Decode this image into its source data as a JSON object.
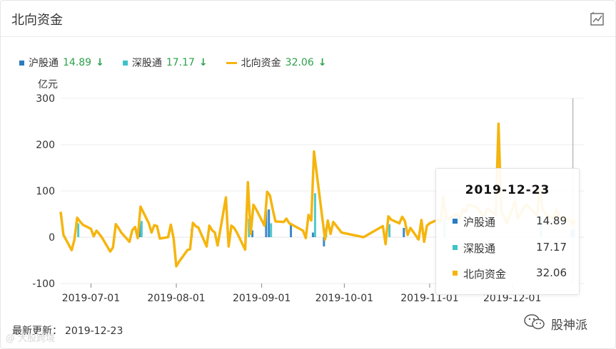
{
  "header": {
    "title": "北向资金",
    "chart_icon": "chart-line-icon"
  },
  "legend": [
    {
      "name": "沪股通",
      "value": "14.89",
      "arrow": "↓",
      "color": "#2a7bc2",
      "kind": "square"
    },
    {
      "name": "深股通",
      "value": "17.17",
      "arrow": "↓",
      "color": "#3cc3c7",
      "kind": "square"
    },
    {
      "name": "北向资金",
      "value": "32.06",
      "arrow": "↓",
      "color": "#f5b50f",
      "kind": "line"
    }
  ],
  "axis": {
    "unit": "亿元"
  },
  "footer": {
    "label": "最新更新：",
    "date": "2019-12-23"
  },
  "tooltip": {
    "date": "2019-12-23",
    "rows": [
      {
        "name": "沪股通",
        "value": "14.89",
        "color": "#2a7bc2"
      },
      {
        "name": "深股通",
        "value": "17.17",
        "color": "#3cc3c7"
      },
      {
        "name": "北向资金",
        "value": "32.06",
        "color": "#f5b50f"
      }
    ]
  },
  "watermark": {
    "text": "股神派",
    "left_text": "@ 大股跨境"
  },
  "chart_data": {
    "type": "bar",
    "ylim": [
      -100,
      300
    ],
    "y_ticks": [
      300,
      200,
      100,
      0,
      -100
    ],
    "x_ticks": [
      "2019-07-01",
      "2019-08-01",
      "2019-09-01",
      "2019-10-01",
      "2019-11-01",
      "2019-12-01"
    ],
    "x_tick_dates": [
      "2019-07-01",
      "2019-08-01",
      "2019-09-01",
      "2019-10-01",
      "2019-11-01",
      "2019-12-01"
    ],
    "x_range": [
      "2019-06-20",
      "2019-12-27"
    ],
    "grid": "horizontal",
    "series": [
      {
        "name": "北向资金",
        "type": "line",
        "color": "#f5b50f",
        "points": [
          [
            "2019-06-20",
            55
          ],
          [
            "2019-06-21",
            5
          ],
          [
            "2019-06-24",
            -28
          ],
          [
            "2019-06-25",
            -5
          ],
          [
            "2019-06-26",
            42
          ],
          [
            "2019-06-27",
            34
          ],
          [
            "2019-06-28",
            27
          ],
          [
            "2019-07-01",
            18
          ],
          [
            "2019-07-02",
            2
          ],
          [
            "2019-07-03",
            14
          ],
          [
            "2019-07-04",
            7
          ],
          [
            "2019-07-05",
            -1
          ],
          [
            "2019-07-08",
            -31
          ],
          [
            "2019-07-09",
            -22
          ],
          [
            "2019-07-10",
            28
          ],
          [
            "2019-07-11",
            20
          ],
          [
            "2019-07-12",
            10
          ],
          [
            "2019-07-15",
            -10
          ],
          [
            "2019-07-16",
            15
          ],
          [
            "2019-07-17",
            22
          ],
          [
            "2019-07-18",
            -2
          ],
          [
            "2019-07-19",
            66
          ],
          [
            "2019-07-22",
            30
          ],
          [
            "2019-07-23",
            10
          ],
          [
            "2019-07-24",
            26
          ],
          [
            "2019-07-25",
            24
          ],
          [
            "2019-07-26",
            -3
          ],
          [
            "2019-07-29",
            0
          ],
          [
            "2019-07-30",
            27
          ],
          [
            "2019-07-31",
            -2
          ],
          [
            "2019-08-01",
            -63
          ],
          [
            "2019-08-02",
            -53
          ],
          [
            "2019-08-05",
            -28
          ],
          [
            "2019-08-06",
            -26
          ],
          [
            "2019-08-07",
            31
          ],
          [
            "2019-08-08",
            24
          ],
          [
            "2019-08-09",
            21
          ],
          [
            "2019-08-12",
            -20
          ],
          [
            "2019-08-13",
            25
          ],
          [
            "2019-08-14",
            15
          ],
          [
            "2019-08-15",
            10
          ],
          [
            "2019-08-16",
            -18
          ],
          [
            "2019-08-19",
            86
          ],
          [
            "2019-08-20",
            -20
          ],
          [
            "2019-08-21",
            25
          ],
          [
            "2019-08-22",
            20
          ],
          [
            "2019-08-23",
            10
          ],
          [
            "2019-08-26",
            -27
          ],
          [
            "2019-08-27",
            119
          ],
          [
            "2019-08-28",
            7
          ],
          [
            "2019-08-29",
            70
          ],
          [
            "2019-08-30",
            60
          ],
          [
            "2019-09-02",
            25
          ],
          [
            "2019-09-03",
            98
          ],
          [
            "2019-09-04",
            90
          ],
          [
            "2019-09-05",
            60
          ],
          [
            "2019-09-06",
            34
          ],
          [
            "2019-09-09",
            33
          ],
          [
            "2019-09-10",
            40
          ],
          [
            "2019-09-11",
            30
          ],
          [
            "2019-09-12",
            27
          ],
          [
            "2019-09-16",
            14
          ],
          [
            "2019-09-17",
            -2
          ],
          [
            "2019-09-18",
            48
          ],
          [
            "2019-09-19",
            36
          ],
          [
            "2019-09-20",
            185
          ],
          [
            "2019-09-23",
            42
          ],
          [
            "2019-09-24",
            -5
          ],
          [
            "2019-09-25",
            36
          ],
          [
            "2019-09-26",
            7
          ],
          [
            "2019-09-27",
            33
          ],
          [
            "2019-09-30",
            10
          ],
          [
            "2019-10-08",
            0
          ],
          [
            "2019-10-15",
            24
          ],
          [
            "2019-10-16",
            -15
          ],
          [
            "2019-10-17",
            45
          ],
          [
            "2019-10-18",
            38
          ],
          [
            "2019-10-21",
            30
          ],
          [
            "2019-10-22",
            44
          ],
          [
            "2019-10-23",
            35
          ],
          [
            "2019-10-24",
            5
          ],
          [
            "2019-10-25",
            20
          ],
          [
            "2019-10-28",
            -5
          ],
          [
            "2019-10-29",
            37
          ],
          [
            "2019-10-30",
            -10
          ],
          [
            "2019-10-31",
            25
          ],
          [
            "2019-11-01",
            30
          ],
          [
            "2019-11-04",
            38
          ],
          [
            "2019-11-05",
            33
          ],
          [
            "2019-11-06",
            87
          ],
          [
            "2019-11-07",
            42
          ],
          [
            "2019-11-08",
            40
          ],
          [
            "2019-11-11",
            50
          ],
          [
            "2019-11-12",
            40
          ],
          [
            "2019-11-13",
            60
          ],
          [
            "2019-11-14",
            55
          ],
          [
            "2019-11-15",
            70
          ],
          [
            "2019-11-18",
            65
          ],
          [
            "2019-11-19",
            58
          ],
          [
            "2019-11-20",
            50
          ],
          [
            "2019-11-21",
            45
          ],
          [
            "2019-11-22",
            62
          ],
          [
            "2019-11-25",
            48
          ],
          [
            "2019-11-26",
            245
          ],
          [
            "2019-11-27",
            55
          ],
          [
            "2019-11-28",
            45
          ],
          [
            "2019-11-29",
            30
          ],
          [
            "2019-12-02",
            78
          ],
          [
            "2019-12-03",
            40
          ],
          [
            "2019-12-04",
            50
          ],
          [
            "2019-12-05",
            62
          ],
          [
            "2019-12-06",
            70
          ],
          [
            "2019-12-09",
            54
          ],
          [
            "2019-12-10",
            45
          ],
          [
            "2019-12-11",
            105
          ],
          [
            "2019-12-12",
            60
          ],
          [
            "2019-12-13",
            50
          ],
          [
            "2019-12-16",
            40
          ],
          [
            "2019-12-17",
            60
          ],
          [
            "2019-12-18",
            48
          ],
          [
            "2019-12-19",
            38
          ],
          [
            "2019-12-20",
            42
          ],
          [
            "2019-12-23",
            32.06
          ]
        ]
      },
      {
        "name": "沪股通",
        "type": "bar",
        "color": "#2a7bc2",
        "points": [
          [
            "2019-07-19",
            30
          ],
          [
            "2019-08-07",
            18
          ],
          [
            "2019-08-29",
            15
          ],
          [
            "2019-09-03",
            58
          ],
          [
            "2019-09-04",
            60
          ],
          [
            "2019-09-12",
            30
          ],
          [
            "2019-09-20",
            10
          ],
          [
            "2019-09-24",
            -20
          ],
          [
            "2019-10-23",
            20
          ],
          [
            "2019-10-28",
            -5
          ],
          [
            "2019-12-23",
            14.89
          ]
        ]
      },
      {
        "name": "深股通",
        "type": "bar",
        "color": "#3cc3c7",
        "points": [
          [
            "2019-06-26",
            30
          ],
          [
            "2019-07-19",
            35
          ],
          [
            "2019-08-27",
            40
          ],
          [
            "2019-09-04",
            30
          ],
          [
            "2019-09-20",
            95
          ],
          [
            "2019-09-24",
            20
          ],
          [
            "2019-10-17",
            28
          ],
          [
            "2019-11-06",
            40
          ],
          [
            "2019-12-11",
            45
          ],
          [
            "2019-12-23",
            17.17
          ]
        ]
      }
    ]
  }
}
